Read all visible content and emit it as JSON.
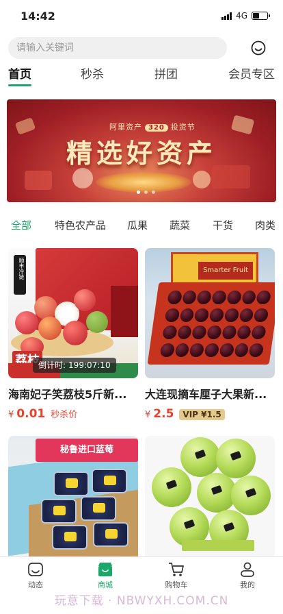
{
  "status_bar": {
    "time": "14:42",
    "network": "4G"
  },
  "search": {
    "placeholder": "请输入关键词"
  },
  "main_tabs": [
    {
      "label": "首页",
      "active": true
    },
    {
      "label": "秒杀",
      "active": false
    },
    {
      "label": "拼团",
      "active": false
    },
    {
      "label": "会员专区",
      "active": false
    }
  ],
  "banner": {
    "brand": "阿里资产",
    "badge": "320",
    "event": "投资节",
    "title": "精选好资产",
    "slide_count": 3,
    "active_slide": 1
  },
  "categories": [
    {
      "label": "全部",
      "active": true
    },
    {
      "label": "特色农产品",
      "active": false
    },
    {
      "label": "瓜果",
      "active": false
    },
    {
      "label": "蔬菜",
      "active": false
    },
    {
      "label": "干货",
      "active": false
    },
    {
      "label": "肉类",
      "active": false
    }
  ],
  "products": [
    {
      "name": "海南妃子笑荔枝5斤新...",
      "currency": "¥",
      "price": "0.01",
      "tag": "秒杀价",
      "countdown_label": "倒计时:",
      "countdown": "199:07:10",
      "image_badge": "顺丰冷链",
      "image_title": "荔枝"
    },
    {
      "name": "大连现摘车厘子大果新...",
      "currency": "¥",
      "price": "2.5",
      "vip_label": "VIP ¥1.5",
      "image_brand": "Smarter Fruit"
    },
    {
      "name": "",
      "image_title": "秘鲁进口蓝莓"
    },
    {
      "name": ""
    }
  ],
  "tabbar": [
    {
      "label": "动态",
      "icon": "feed-icon",
      "active": false
    },
    {
      "label": "商城",
      "icon": "shop-icon",
      "active": true
    },
    {
      "label": "购物车",
      "icon": "cart-icon",
      "active": false
    },
    {
      "label": "我的",
      "icon": "user-icon",
      "active": false
    }
  ],
  "watermark": "玩意下载 · NBWYXH.COM.CN",
  "colors": {
    "accent": "#1aa86a",
    "price": "#e8422f",
    "vip": "#e5c98c"
  }
}
